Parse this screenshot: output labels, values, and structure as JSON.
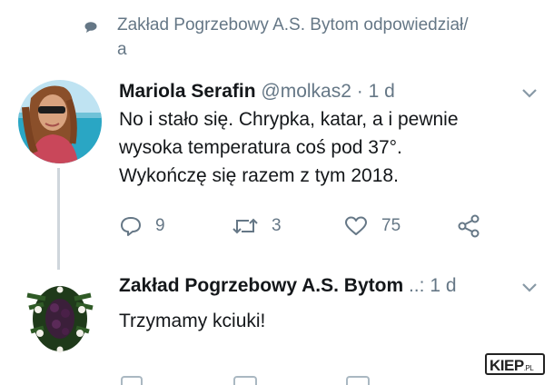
{
  "reply_context": {
    "line1": "Zakład Pogrzebowy A.S. Bytom odpowiedział/",
    "line2": "a",
    "icon": "speech-bubble-icon"
  },
  "tweet1": {
    "name": "Mariola Serafin",
    "handle": "@molkas2",
    "separator": "·",
    "time": "1 d",
    "lines": [
      "No i stało się. Chrypka, katar, a i pewnie",
      "wysoka temperatura coś pod 37°.",
      "Wykończę się razem z tym 2018."
    ],
    "actions": {
      "reply_count": "9",
      "retweet_count": "3",
      "like_count": "75"
    }
  },
  "tweet2": {
    "name": "Zakład Pogrzebowy A.S. Bytom",
    "truncation": "..:",
    "time": "1 d",
    "text": "Trzymamy kciuki!"
  },
  "watermark": {
    "text": "KIEP",
    "suffix": ".PL"
  },
  "colors": {
    "text": "#14171a",
    "secondary": "#657786",
    "thread_line": "#cfd6dc"
  }
}
